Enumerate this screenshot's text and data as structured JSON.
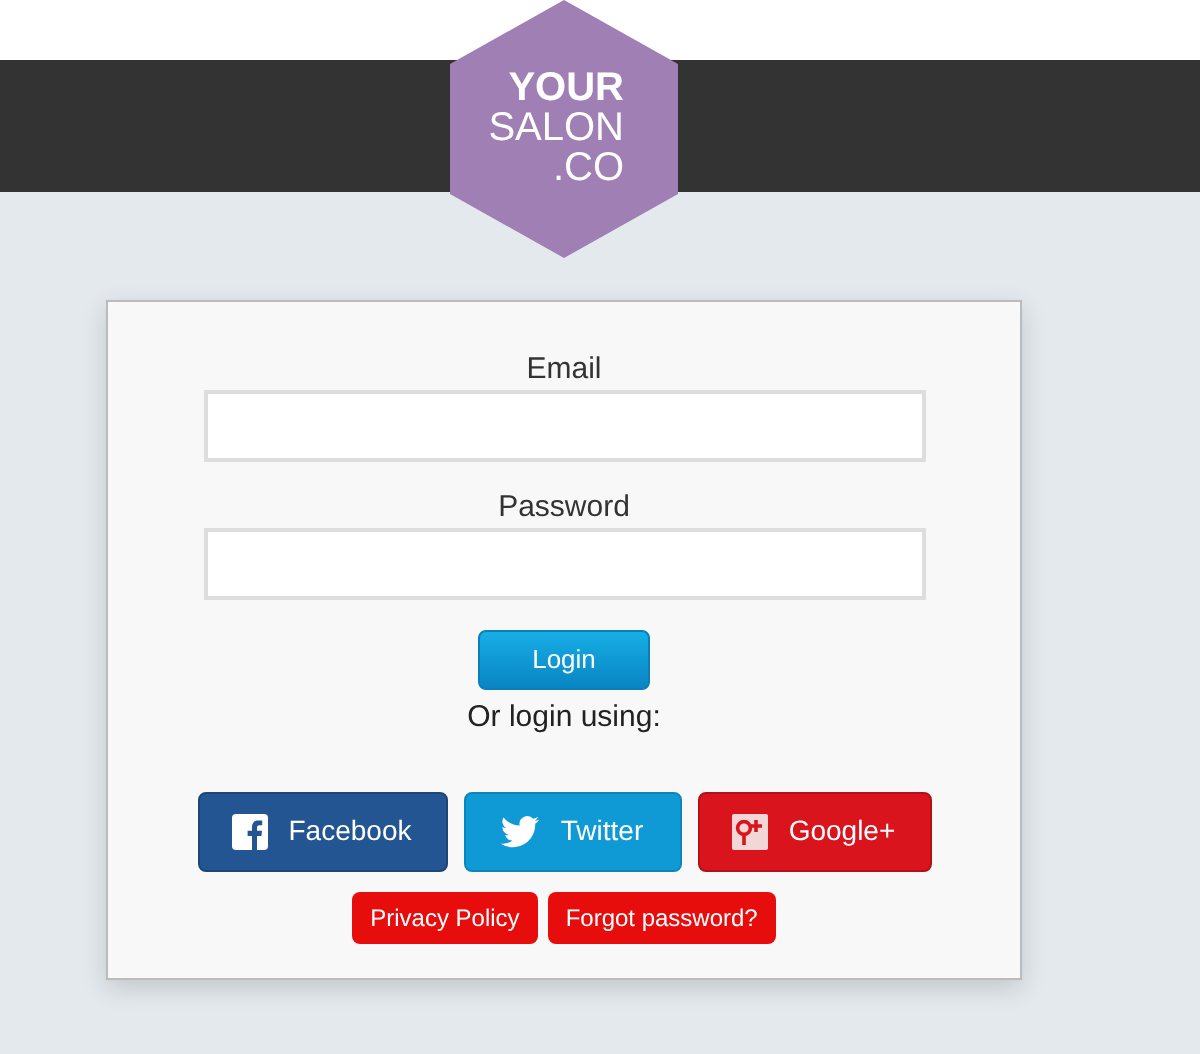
{
  "logo": {
    "lines": [
      "YOUR",
      "SALON",
      ".CO"
    ]
  },
  "form": {
    "fields": [
      {
        "label": "Email"
      },
      {
        "label": "Password"
      }
    ],
    "login_button": "Login",
    "alt_text": "Or login using:",
    "social_buttons": [
      {
        "kind": "facebook",
        "label": "Facebook"
      },
      {
        "kind": "twitter",
        "label": "Twitter"
      },
      {
        "kind": "google",
        "label": "Google+"
      }
    ],
    "links": [
      "Privacy Policy",
      "Forgot password?"
    ]
  }
}
